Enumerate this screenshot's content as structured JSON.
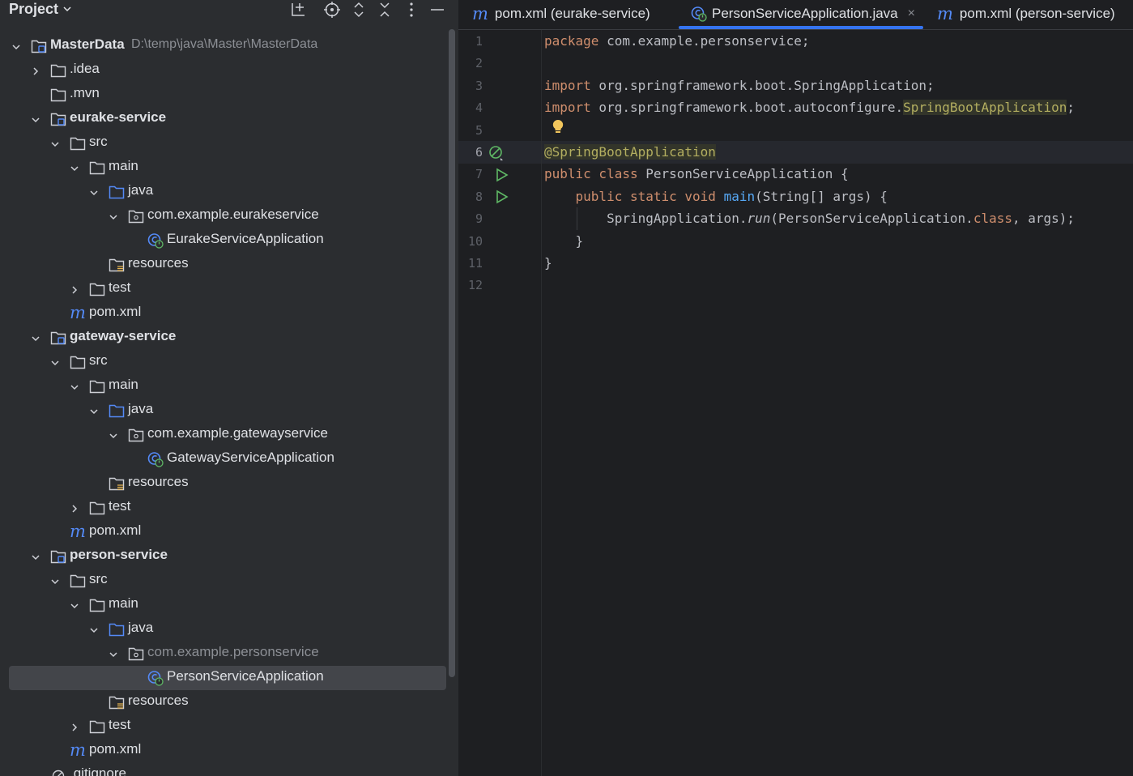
{
  "project_panel": {
    "title": "Project",
    "tree": [
      {
        "label": "MasterData",
        "path": "D:\\temp\\java\\Master\\MasterData",
        "bold": true,
        "icon": "module-folder",
        "depth": 0,
        "chevron": "down"
      },
      {
        "label": ".idea",
        "icon": "folder",
        "depth": 1,
        "chevron": "right"
      },
      {
        "label": ".mvn",
        "icon": "folder",
        "depth": 1,
        "chevron": "none"
      },
      {
        "label": "eurake-service",
        "bold": true,
        "icon": "module-folder",
        "depth": 1,
        "chevron": "down"
      },
      {
        "label": "src",
        "icon": "folder",
        "depth": 2,
        "chevron": "down"
      },
      {
        "label": "main",
        "icon": "folder",
        "depth": 3,
        "chevron": "down"
      },
      {
        "label": "java",
        "icon": "source-folder",
        "depth": 4,
        "chevron": "down"
      },
      {
        "label": "com.example.eurakeservice",
        "icon": "package",
        "depth": 5,
        "chevron": "down"
      },
      {
        "label": "EurakeServiceApplication",
        "icon": "spring-class",
        "depth": 6,
        "chevron": "none"
      },
      {
        "label": "resources",
        "icon": "resources-folder",
        "depth": 4,
        "chevron": "none"
      },
      {
        "label": "test",
        "icon": "folder",
        "depth": 3,
        "chevron": "right"
      },
      {
        "label": "pom.xml",
        "icon": "maven",
        "depth": 2,
        "chevron": "none"
      },
      {
        "label": "gateway-service",
        "bold": true,
        "icon": "module-folder",
        "depth": 1,
        "chevron": "down"
      },
      {
        "label": "src",
        "icon": "folder",
        "depth": 2,
        "chevron": "down"
      },
      {
        "label": "main",
        "icon": "folder",
        "depth": 3,
        "chevron": "down"
      },
      {
        "label": "java",
        "icon": "source-folder",
        "depth": 4,
        "chevron": "down"
      },
      {
        "label": "com.example.gatewayservice",
        "icon": "package",
        "depth": 5,
        "chevron": "down"
      },
      {
        "label": "GatewayServiceApplication",
        "icon": "spring-class",
        "depth": 6,
        "chevron": "none"
      },
      {
        "label": "resources",
        "icon": "resources-folder",
        "depth": 4,
        "chevron": "none"
      },
      {
        "label": "test",
        "icon": "folder",
        "depth": 3,
        "chevron": "right"
      },
      {
        "label": "pom.xml",
        "icon": "maven",
        "depth": 2,
        "chevron": "none"
      },
      {
        "label": "person-service",
        "bold": true,
        "icon": "module-folder",
        "depth": 1,
        "chevron": "down"
      },
      {
        "label": "src",
        "icon": "folder",
        "depth": 2,
        "chevron": "down"
      },
      {
        "label": "main",
        "icon": "folder",
        "depth": 3,
        "chevron": "down"
      },
      {
        "label": "java",
        "icon": "source-folder",
        "depth": 4,
        "chevron": "down"
      },
      {
        "label": "com.example.personservice",
        "icon": "package",
        "depth": 5,
        "chevron": "down",
        "dim": true
      },
      {
        "label": "PersonServiceApplication",
        "icon": "spring-class",
        "depth": 6,
        "chevron": "none",
        "selected": true
      },
      {
        "label": "resources",
        "icon": "resources-folder",
        "depth": 4,
        "chevron": "none"
      },
      {
        "label": "test",
        "icon": "folder",
        "depth": 3,
        "chevron": "right"
      },
      {
        "label": "pom.xml",
        "icon": "maven",
        "depth": 2,
        "chevron": "none"
      },
      {
        "label": ".gitignore",
        "icon": "ignore-file",
        "depth": 1,
        "chevron": "none"
      }
    ]
  },
  "tabs": [
    {
      "label": "pom.xml (eurake-service)",
      "icon": "maven",
      "active": false
    },
    {
      "label": "PersonServiceApplication.java",
      "icon": "spring-class",
      "active": true,
      "closable": true
    },
    {
      "label": "pom.xml (person-service)",
      "icon": "maven",
      "active": false
    }
  ],
  "tab_icon_glyph": "m",
  "tab_close_glyph": "×",
  "editor": {
    "current_line": 6,
    "lines": [
      [
        {
          "t": "package",
          "c": "kw"
        },
        {
          "t": " com.example.personservice;"
        }
      ],
      [],
      [
        {
          "t": "import",
          "c": "kw"
        },
        {
          "t": " org.springframework.boot.SpringApplication;"
        }
      ],
      [
        {
          "t": "import",
          "c": "kw"
        },
        {
          "t": " org.springframework.boot.autoconfigure."
        },
        {
          "t": "SpringBootApplication",
          "c": "ann annbg"
        },
        {
          "t": ";"
        }
      ],
      [],
      [
        {
          "t": "@SpringBootApplication",
          "c": "ann annbg"
        }
      ],
      [
        {
          "t": "public class",
          "c": "kw"
        },
        {
          "t": " PersonServiceApplication {"
        }
      ],
      [
        {
          "t": "    "
        },
        {
          "t": "public static void",
          "c": "kw"
        },
        {
          "t": " "
        },
        {
          "t": "main",
          "c": "fn"
        },
        {
          "t": "(String[] args) {"
        }
      ],
      [
        {
          "t": "        SpringApplication."
        },
        {
          "t": "run",
          "c": "it"
        },
        {
          "t": "(PersonServiceApplication."
        },
        {
          "t": "class",
          "c": "kw"
        },
        {
          "t": ", args);"
        }
      ],
      [
        {
          "t": "    }"
        }
      ],
      [
        {
          "t": "}"
        }
      ],
      []
    ]
  },
  "colors": {
    "accent": "#3574f0",
    "keyword": "#cf8e6d",
    "annotation": "#b3ae60",
    "function": "#56a8f5",
    "run_icon": "#5fb865",
    "bulb": "#f2c55c"
  }
}
